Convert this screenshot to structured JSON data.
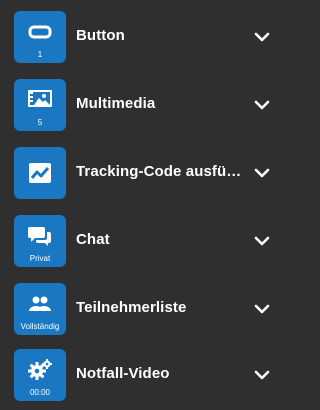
{
  "items": [
    {
      "title": "Button",
      "sub": "1",
      "icon": "button-icon"
    },
    {
      "title": "Multimedia",
      "sub": "5",
      "icon": "multimedia-icon"
    },
    {
      "title": "Tracking-Code ausführen",
      "sub": "",
      "icon": "chart-icon"
    },
    {
      "title": "Chat",
      "sub": "Privat",
      "icon": "chat-icon"
    },
    {
      "title": "Teilnehmerliste",
      "sub": "Vollständig",
      "icon": "participants-icon"
    },
    {
      "title": "Notfall-Video",
      "sub": "00:00",
      "icon": "gears-icon"
    }
  ],
  "colors": {
    "tile": "#1a78c2",
    "background": "#2f2f2f"
  }
}
